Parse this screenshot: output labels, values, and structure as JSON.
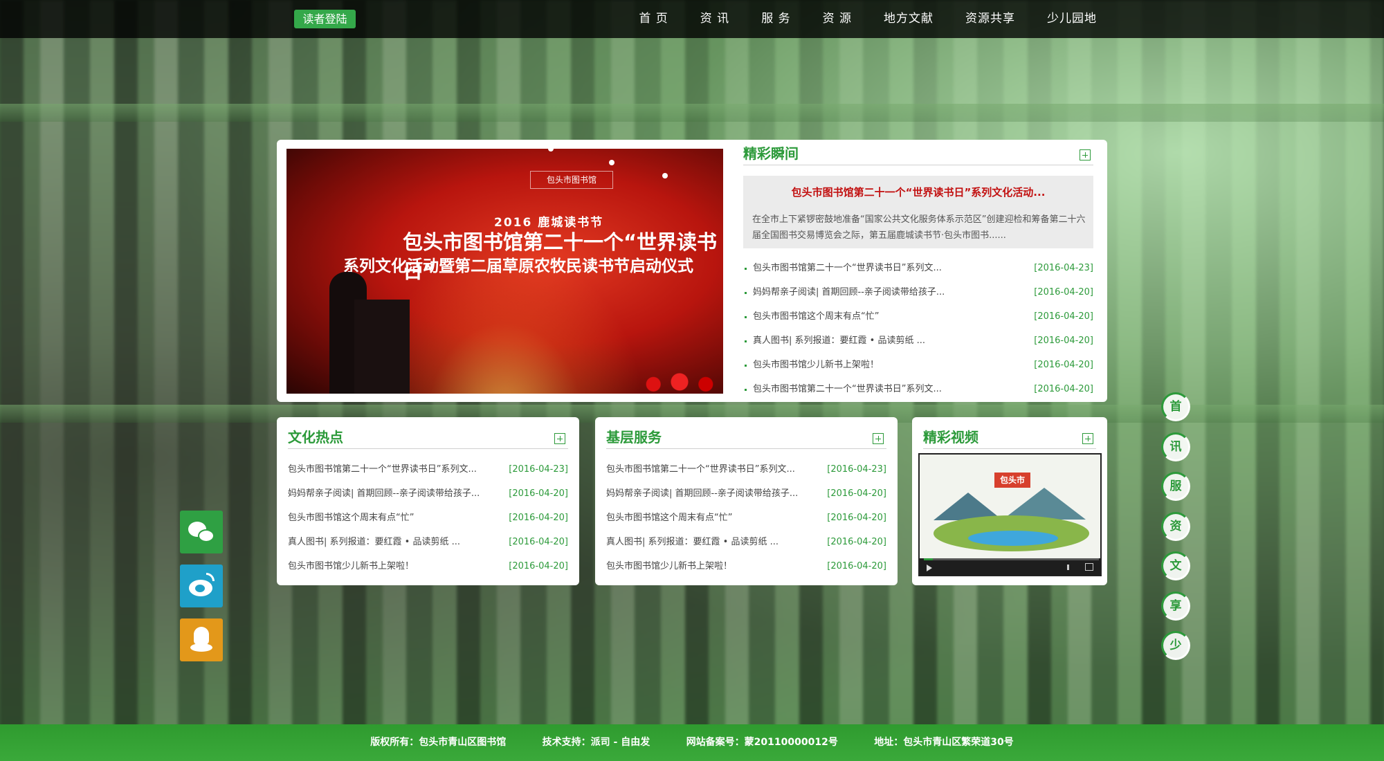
{
  "topbar": {
    "login_label": "读者登陆",
    "nav": [
      "首 页",
      "资 讯",
      "服 务",
      "资 源",
      "地方文献",
      "资源共享",
      "少儿园地"
    ]
  },
  "slideshow": {
    "logo_text": "包头市图书馆",
    "line1": "2016 鹿城读书节",
    "line2": "包头市图书馆第二十一个“世界读书日”",
    "line3": "系列文化活动暨第二届草原农牧民读书节启动仪式"
  },
  "highlights": {
    "title": "精彩瞬间",
    "featured_title": "包头市图书馆第二十一个“世界读书日”系列文化活动...",
    "featured_desc": "在全市上下紧锣密鼓地准备“国家公共文化服务体系示范区”创建迎检和筹备第二十六届全国图书交易博览会之际，第五届鹿城读书节·包头市图书......",
    "items": [
      {
        "title": "包头市图书馆第二十一个“世界读书日”系列文...",
        "date": "[2016-04-23]"
      },
      {
        "title": "妈妈帮亲子阅读| 首期回顾--亲子阅读带给孩子...",
        "date": "[2016-04-20]"
      },
      {
        "title": "包头市图书馆这个周末有点“忙”",
        "date": "[2016-04-20]"
      },
      {
        "title": "真人图书| 系列报道：要红霞 • 品读剪纸 ...",
        "date": "[2016-04-20]"
      },
      {
        "title": "包头市图书馆少儿新书上架啦！",
        "date": "[2016-04-20]"
      },
      {
        "title": "包头市图书馆第二十一个“世界读书日”系列文...",
        "date": "[2016-04-20]"
      }
    ]
  },
  "culture": {
    "title": "文化热点",
    "items": [
      {
        "title": "包头市图书馆第二十一个“世界读书日”系列文...",
        "date": "[2016-04-23]"
      },
      {
        "title": "妈妈帮亲子阅读| 首期回顾--亲子阅读带给孩子...",
        "date": "[2016-04-20]"
      },
      {
        "title": "包头市图书馆这个周末有点“忙”",
        "date": "[2016-04-20]"
      },
      {
        "title": "真人图书| 系列报道：要红霞 • 品读剪纸 ...",
        "date": "[2016-04-20]"
      },
      {
        "title": "包头市图书馆少儿新书上架啦！",
        "date": "[2016-04-20]"
      }
    ]
  },
  "grassroots": {
    "title": "基层服务",
    "items": [
      {
        "title": "包头市图书馆第二十一个“世界读书日”系列文...",
        "date": "[2016-04-23]"
      },
      {
        "title": "妈妈帮亲子阅读| 首期回顾--亲子阅读带给孩子...",
        "date": "[2016-04-20]"
      },
      {
        "title": "包头市图书馆这个周末有点“忙”",
        "date": "[2016-04-20]"
      },
      {
        "title": "真人图书| 系列报道：要红霞 • 品读剪纸 ...",
        "date": "[2016-04-20]"
      },
      {
        "title": "包头市图书馆少儿新书上架啦！",
        "date": "[2016-04-20]"
      }
    ]
  },
  "video": {
    "title": "精彩视频",
    "badge": "包头市",
    "progress": 0.05
  },
  "side_nav": [
    "首",
    "讯",
    "服",
    "资",
    "文",
    "享",
    "少"
  ],
  "footer": {
    "copyright": "版权所有：包头市青山区图书馆",
    "tech": "技术支持：派司 - 自由发",
    "icp": "网站备案号：蒙20110000012号",
    "address": "地址：包头市青山区繁荣道30号"
  },
  "colors": {
    "accent": "#2c9a3a",
    "featured_title": "#c21010",
    "footer": "#36a336"
  }
}
